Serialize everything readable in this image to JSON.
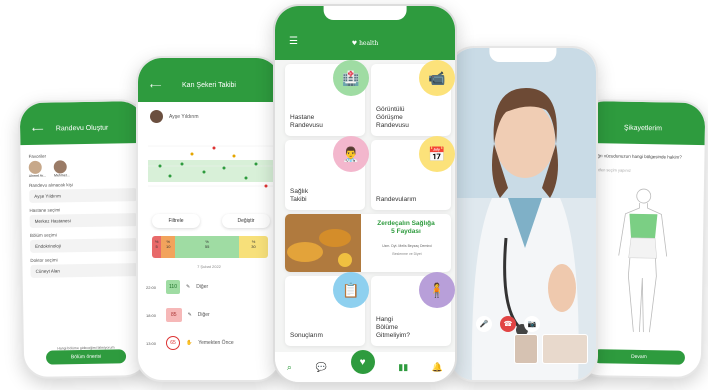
{
  "phone1": {
    "title": "Randevu Oluştur",
    "favorites_label": "Favoriler",
    "fav_names": [
      "Ahmet Ar...",
      "Mehmet..."
    ],
    "fields": [
      {
        "label": "Randevu alınacak kişi",
        "value": "Ayşe Yıldırım"
      },
      {
        "label": "Hastane seçimi",
        "value": "Merkez Hastanesi"
      },
      {
        "label": "Bölüm seçimi",
        "value": "Endokrinoloji"
      },
      {
        "label": "Doktor seçimi",
        "value": "Cüneyt Alan"
      }
    ],
    "note": "Hangi bölüme gideceğimi bilmiyorum",
    "submit": "Bölüm önerisi"
  },
  "phone2": {
    "title": "Kan Şekeri Takibi",
    "user": "Ayşe Yıldırım",
    "filter": "Filtrele",
    "change": "Değiştir",
    "bar": [
      {
        "top": "%",
        "val": "5"
      },
      {
        "top": "%",
        "val": "10"
      },
      {
        "top": "%",
        "val": "55"
      },
      {
        "top": "%",
        "val": "30"
      }
    ],
    "date": "7 Şubat 2022",
    "readings": [
      {
        "time": "22:00",
        "value": "110",
        "note": "Diğer"
      },
      {
        "time": "18:00",
        "value": "85",
        "note": "Diğer"
      },
      {
        "time": "13:00",
        "value": "65",
        "note": "Yemekten Önce"
      }
    ]
  },
  "phone3": {
    "logo": "health",
    "tiles": [
      {
        "label": "Hastane\nRandevusu",
        "icon": "hospital-icon"
      },
      {
        "label": "Görüntülü\nGörüşme\nRandevusu",
        "icon": "video-camera-icon"
      },
      {
        "label": "Sağlık\nTakibi",
        "icon": "doctor-icon"
      },
      {
        "label": "Randevularım",
        "icon": "calendar-icon"
      },
      {
        "label": "Sonuçlarım",
        "icon": "clipboard-icon"
      },
      {
        "label": "Hangi\nBölüme\nGitmeliyim?",
        "icon": "body-icon"
      }
    ],
    "banner": {
      "title": "Zerdeçalın Sağlığa\n5 Faydası",
      "author": "Uzm. Dyt. Melis Beyzaç Demirci",
      "sub": "Beslenme ve Diyet"
    }
  },
  "phone4": {
    "controls": [
      "mic-icon",
      "hang-up-icon",
      "camera-icon"
    ]
  },
  "phone5": {
    "title": "Şikayetlerim",
    "question": "Ağrı vücudunuzun hangi bölgesinde hakim?",
    "hint": "Lütfen seçim yapınız",
    "submit": "Devam"
  },
  "colors": {
    "brand": "#2e9b3e",
    "yellow": "#fce27a",
    "blue": "#8ed0ef",
    "pink": "#f3b7cd",
    "purple": "#b89fd9",
    "green_light": "#9fdca3"
  }
}
